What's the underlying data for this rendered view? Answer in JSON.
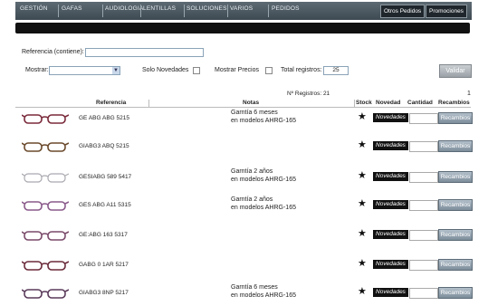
{
  "nav": {
    "items": [
      "GESTIÓN",
      "GAFAS",
      "AUDIOLOGIA",
      "LENTILLAS",
      "SOLUCIONES",
      "VARIOS",
      "PEDIDOS"
    ],
    "otros_pedidos": "Otros Pedidos",
    "promociones": "Promociones"
  },
  "filters": {
    "referencia_label": "Referencia (contiene):",
    "referencia_value": "",
    "mostrar_label": "Mostrar:",
    "mostrar_value": "",
    "solo_novedades_label": "Solo Novedades",
    "mostrar_precios_label": "Mostrar Precios",
    "total_registros_label": "Total registros:",
    "total_registros_value": "25",
    "validar_label": "Validar"
  },
  "results": {
    "registros_text": "Nº Registros: 21",
    "page_number": "1"
  },
  "columns": {
    "referencia": "Referencia",
    "notas": "Notas",
    "stock": "Stock",
    "novedad": "Novedad",
    "cantidad": "Cantidad",
    "recambios": "Recambios"
  },
  "rows": [
    {
      "ref": "GE ABG ABG 5215",
      "note1": "Garntía 6 meses",
      "note2": "en modelos AHRG-165",
      "novedad": "Novedades",
      "recambios": "Recambios",
      "frame_color": "#7a2a3a"
    },
    {
      "ref": "GIABG3 ABQ 5215",
      "note1": "",
      "note2": "",
      "novedad": "Novedades",
      "recambios": "Recambios",
      "frame_color": "#6b4a2c"
    },
    {
      "ref": "GESIABG 589 5417",
      "note1": "Garntía 2 años",
      "note2": "en modelos AHRG-165",
      "novedad": "Novedades",
      "recambios": "Recambios",
      "frame_color": "#a9a9b0"
    },
    {
      "ref": "GES ABG A11 5315",
      "note1": "Garntía 2 años",
      "note2": "en modelos AHRG-165",
      "novedad": "Novedades",
      "recambios": "Recambios",
      "frame_color": "#8a5a8a"
    },
    {
      "ref": "GE:ABG 163 5317",
      "note1": "",
      "note2": "",
      "novedad": "Novedades",
      "recambios": "Recambios",
      "frame_color": "#7a4a6a"
    },
    {
      "ref": "GABG 0 1AR 5217",
      "note1": "",
      "note2": "",
      "novedad": "Novedades",
      "recambios": "Recambios",
      "frame_color": "#6a2a3a"
    },
    {
      "ref": "GIABG3 8NP 5217",
      "note1": "Garntía 6 meses",
      "note2": "en modelos AHRG-165",
      "novedad": "Novedades",
      "recambios": "Recambios",
      "frame_color": "#5a3a5a"
    }
  ]
}
